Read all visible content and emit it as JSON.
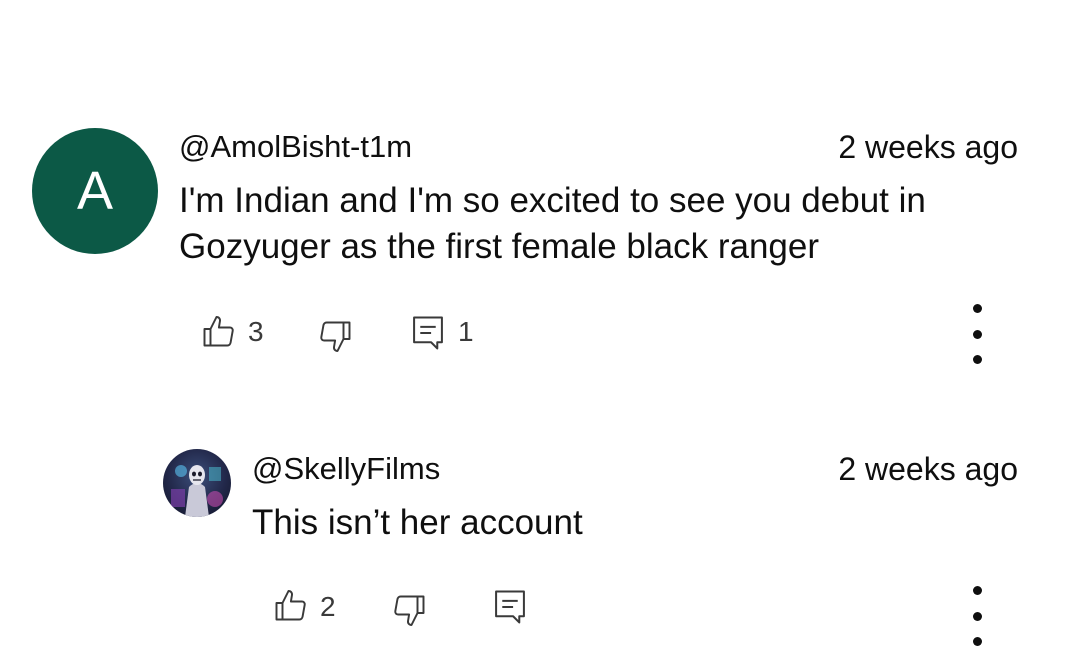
{
  "comments": [
    {
      "avatar_letter": "A",
      "avatar_color": "#0c5946",
      "author": "@AmolBisht-t1m",
      "time": "2 weeks ago",
      "text_line1": "I'm Indian and I'm so excited to see you debut in",
      "text_line2": "Gozyuger as the first female black ranger",
      "likes": "3",
      "replies": "1",
      "icons": [
        "thumbs-up-icon",
        "thumbs-down-icon",
        "reply-icon",
        "more-vertical-icon"
      ]
    },
    {
      "avatar": "profile-image",
      "author": "@SkellyFilms",
      "time": "2 weeks ago",
      "text": "This isn’t her account",
      "likes": "2",
      "icons": [
        "thumbs-up-icon",
        "thumbs-down-icon",
        "reply-icon",
        "more-vertical-icon"
      ]
    }
  ]
}
